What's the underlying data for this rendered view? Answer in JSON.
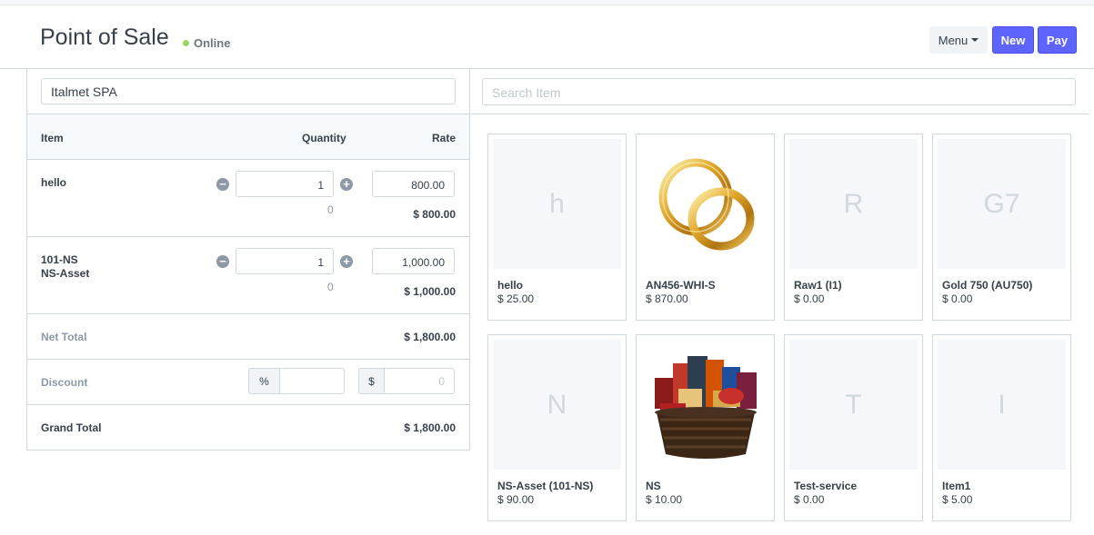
{
  "app": {
    "title": "Point of Sale",
    "status": "Online",
    "status_color": "#98d85b",
    "accent_color": "#5e64ff"
  },
  "toolbar": {
    "menu_label": "Menu",
    "new_label": "New",
    "pay_label": "Pay"
  },
  "cart": {
    "customer": "Italmet SPA",
    "headers": {
      "item": "Item",
      "quantity": "Quantity",
      "rate": "Rate"
    },
    "items": [
      {
        "name_line1": "hello",
        "name_line2": "",
        "qty": "1",
        "available": "0",
        "rate": "800.00",
        "amount": "$ 800.00"
      },
      {
        "name_line1": "101-NS",
        "name_line2": "NS-Asset",
        "qty": "1",
        "available": "0",
        "rate": "1,000.00",
        "amount": "$ 1,000.00"
      }
    ],
    "net_total_label": "Net Total",
    "net_total": "$ 1,800.00",
    "discount_label": "Discount",
    "discount_pct_addon": "%",
    "discount_pct_value": "",
    "discount_amt_addon": "$",
    "discount_amt_placeholder": "0",
    "grand_total_label": "Grand Total",
    "grand_total": "$ 1,800.00"
  },
  "search": {
    "placeholder": "Search Item"
  },
  "products": [
    {
      "initial": "h",
      "name": "hello",
      "price": "$ 25.00",
      "image": ""
    },
    {
      "initial": "",
      "name": "AN456-WHI-S",
      "price": "$ 870.00",
      "image": "gold-rings"
    },
    {
      "initial": "R",
      "name": "Raw1 (I1)",
      "price": "$ 0.00",
      "image": ""
    },
    {
      "initial": "G7",
      "name": "Gold 750 (AU750)",
      "price": "$ 0.00",
      "image": ""
    },
    {
      "initial": "N",
      "name": "NS-Asset (101-NS)",
      "price": "$ 90.00",
      "image": ""
    },
    {
      "initial": "",
      "name": "NS",
      "price": "$ 10.00",
      "image": "gift-basket"
    },
    {
      "initial": "T",
      "name": "Test-service",
      "price": "$ 0.00",
      "image": ""
    },
    {
      "initial": "I",
      "name": "Item1",
      "price": "$ 5.00",
      "image": ""
    }
  ]
}
